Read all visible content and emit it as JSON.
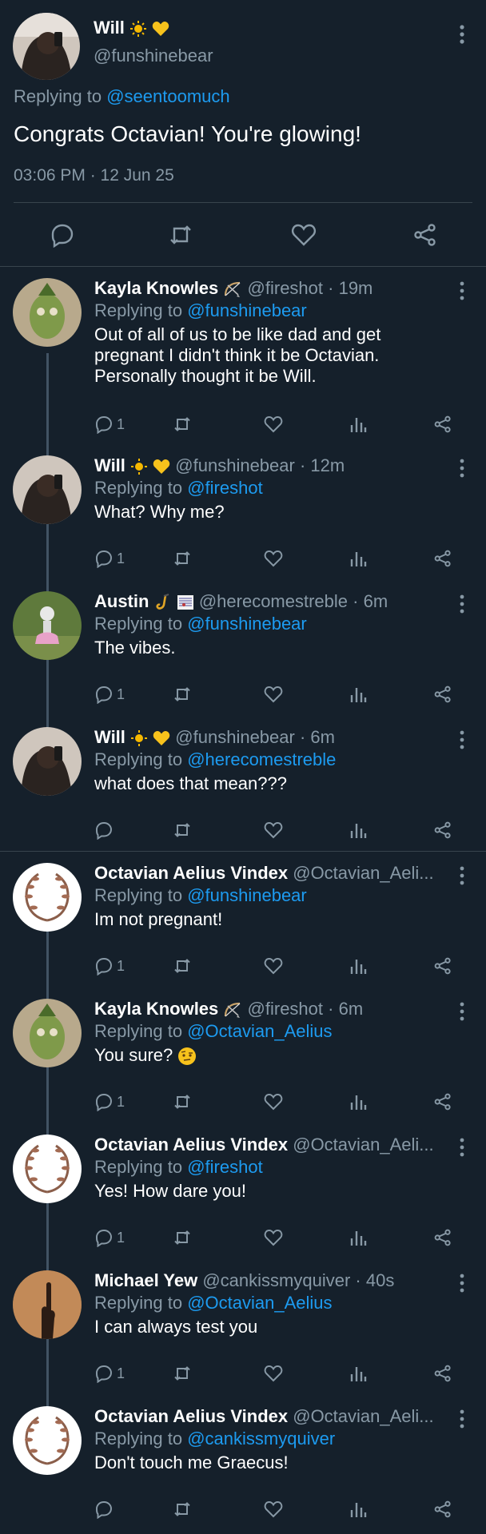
{
  "main_tweet": {
    "name": "Will",
    "handle": "@funshinebear",
    "replying_prefix": "Replying to",
    "replying_to": "@seentoomuch",
    "text": "Congrats Octavian! You're glowing!",
    "timestamp": "03:06 PM · 12 Jun 25",
    "actions": [
      "reply-icon",
      "retweet-icon",
      "like-icon",
      "share-icon"
    ]
  },
  "replies": [
    {
      "name": "Kayla Knowles",
      "handle": "@fireshot",
      "time": "· 19m",
      "replying_prefix": "Replying to",
      "replying_to": "@funshinebear",
      "text": "Out of all of us to be like dad and get pregnant I didn't think it be Octavian. Personally thought it be Will.",
      "reply_count": "1"
    },
    {
      "name": "Will",
      "handle": "@funshinebear",
      "time": "· 12m",
      "replying_prefix": "Replying to",
      "replying_to": "@fireshot",
      "text": "What? Why me?",
      "reply_count": "1"
    },
    {
      "name": "Austin",
      "handle": "@herecomestreble",
      "time": "· 6m",
      "replying_prefix": "Replying to",
      "replying_to": "@funshinebear",
      "text": "The vibes.",
      "reply_count": "1"
    },
    {
      "name": "Will",
      "handle": "@funshinebear",
      "time": "· 6m",
      "replying_prefix": "Replying to",
      "replying_to": "@herecomestreble",
      "text": "what does that mean???",
      "reply_count": ""
    },
    {
      "name": "Octavian Aelius Vindex",
      "handle": "@Octavian_Aeli...",
      "time": "",
      "replying_prefix": "Replying to",
      "replying_to": "@funshinebear",
      "text": "Im not pregnant!",
      "reply_count": "1"
    },
    {
      "name": "Kayla Knowles",
      "handle": "@fireshot",
      "time": "· 6m",
      "replying_prefix": "Replying to",
      "replying_to": "@Octavian_Aelius",
      "text": "You sure?",
      "reply_count": "1"
    },
    {
      "name": "Octavian Aelius Vindex",
      "handle": "@Octavian_Aeli...",
      "time": "",
      "replying_prefix": "Replying to",
      "replying_to": "@fireshot",
      "text": "Yes! How dare you!",
      "reply_count": "1"
    },
    {
      "name": "Michael Yew",
      "handle": "@cankissmyquiver",
      "time": "· 40s",
      "replying_prefix": "Replying to",
      "replying_to": "@Octavian_Aelius",
      "text": "I can always test you",
      "reply_count": "1"
    },
    {
      "name": "Octavian Aelius Vindex",
      "handle": "@Octavian_Aeli...",
      "time": "",
      "replying_prefix": "Replying to",
      "replying_to": "@cankissmyquiver",
      "text": "Don't touch me Graecus!",
      "reply_count": ""
    }
  ],
  "colors": {
    "background": "#15202b",
    "link": "#1d9bf0",
    "muted": "#8899a6",
    "divider": "#38444d"
  }
}
